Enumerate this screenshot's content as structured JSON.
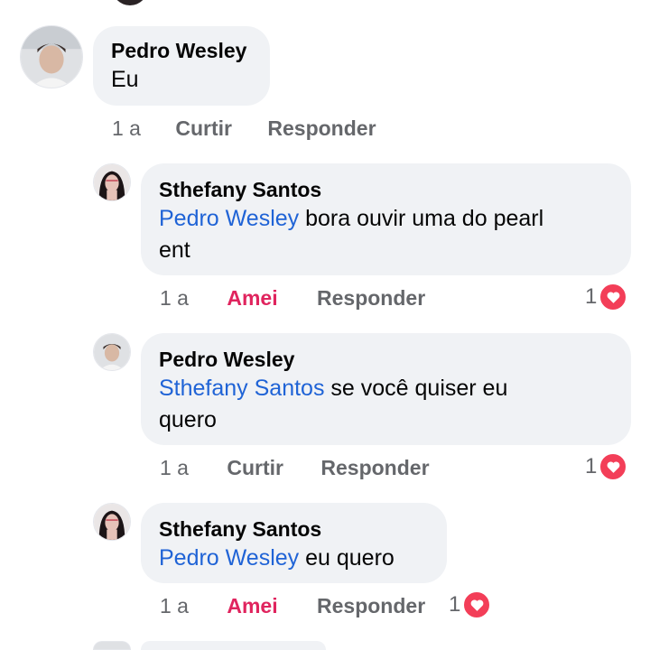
{
  "comments": [
    {
      "id": "c1",
      "author": "Pedro Wesley",
      "text": "Eu",
      "age": "1 a",
      "primary_action": "Curtir",
      "reply_label": "Responder"
    },
    {
      "id": "r1",
      "author": "Sthefany Santos",
      "mention": "Pedro Wesley",
      "text_line1": " bora ouvir uma do pearl",
      "text_line2": "ent",
      "age": "1 a",
      "primary_action": "Amei",
      "reply_label": "Responder",
      "reaction_count": "1",
      "reaction_icon": "heart-icon"
    },
    {
      "id": "r2",
      "author": "Pedro Wesley",
      "mention": "Sthefany Santos",
      "text_line1": " se você quiser eu",
      "text_line2": "quero",
      "age": "1 a",
      "primary_action": "Curtir",
      "reply_label": "Responder",
      "reaction_count": "1",
      "reaction_icon": "heart-icon"
    },
    {
      "id": "r3",
      "author": "Sthefany Santos",
      "mention": "Pedro Wesley",
      "text_line1": " eu quero",
      "age": "1 a",
      "primary_action": "Amei",
      "reply_label": "Responder",
      "reaction_count": "1",
      "reaction_icon": "heart-icon"
    }
  ],
  "colors": {
    "bubble": "#f0f2f5",
    "mention": "#1f63d6",
    "loved": "#e0245e",
    "heart": "#f33e58",
    "meta": "#65676b"
  }
}
